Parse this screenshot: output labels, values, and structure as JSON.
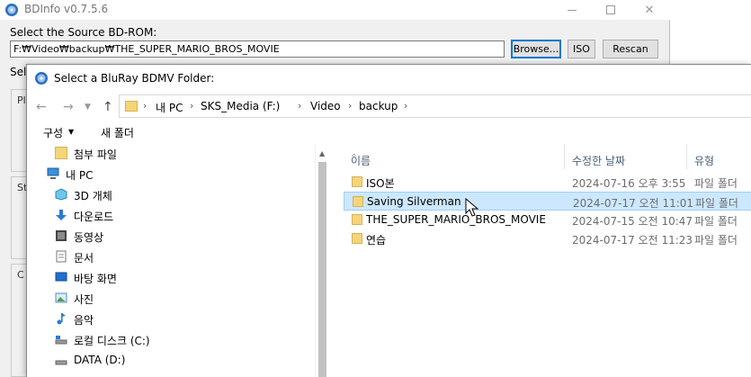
{
  "main_window": {
    "title": "BDInfo v0.7.5.6",
    "source_label": "Select the Source BD-ROM:",
    "source_path": "F:₩Video₩backup₩THE_SUPER_MARIO_BROS_MOVIE",
    "browse_label": "Browse...",
    "iso_label": "ISO",
    "rescan_label": "Rescan",
    "sel_label_partial": "Sel",
    "group_labels": [
      "Pl",
      "St",
      "C"
    ]
  },
  "dialog": {
    "title": "Select a BluRay BDMV Folder:",
    "breadcrumbs": [
      "내 PC",
      "SKS_Media (F:)",
      "Video",
      "backup"
    ],
    "toolbar": {
      "organize": "구성",
      "new_folder": "새 폴더"
    },
    "tree": [
      {
        "label": "첨부 파일",
        "icon": "folder-icon"
      },
      {
        "label": "내 PC",
        "icon": "computer-icon"
      },
      {
        "label": "3D 개체",
        "icon": "3d-objects-icon"
      },
      {
        "label": "다운로드",
        "icon": "download-icon"
      },
      {
        "label": "동영상",
        "icon": "video-icon"
      },
      {
        "label": "문서",
        "icon": "document-icon"
      },
      {
        "label": "바탕 화면",
        "icon": "desktop-icon"
      },
      {
        "label": "사진",
        "icon": "pictures-icon"
      },
      {
        "label": "음악",
        "icon": "music-icon"
      },
      {
        "label": "로컬 디스크 (C:)",
        "icon": "drive-icon"
      },
      {
        "label": "DATA (D:)",
        "icon": "drive-icon"
      }
    ],
    "columns": {
      "name": "이름",
      "date": "수정한 날짜",
      "type": "유형"
    },
    "rows": [
      {
        "name": "ISO본",
        "date": "2024-07-16 오후 3:55",
        "type": "파일 폴더"
      },
      {
        "name": "Saving Silverman",
        "date": "2024-07-17 오전 11:01",
        "type": "파일 폴더"
      },
      {
        "name": "THE_SUPER_MARIO_BROS_MOVIE",
        "date": "2024-07-15 오전 10:47",
        "type": "파일 폴더"
      },
      {
        "name": "연습",
        "date": "2024-07-17 오전 11:23",
        "type": "파일 폴더"
      }
    ]
  },
  "colors": {
    "selection": "#cce8ff",
    "selection_border": "#99d1ff",
    "folder": "#f3d57a",
    "accent": "#0078d7"
  }
}
